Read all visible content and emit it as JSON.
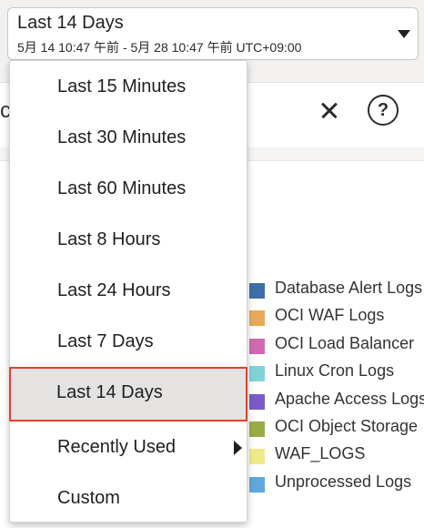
{
  "range": {
    "label": "Last 14 Days",
    "subtext": "5月 14 10:47 午前 - 5月 28 10:47 午前 UTC+09:00"
  },
  "toolbar": {
    "partial_text": "c"
  },
  "menu": {
    "items": [
      {
        "label": "Last 15 Minutes"
      },
      {
        "label": "Last 30 Minutes"
      },
      {
        "label": "Last 60 Minutes"
      },
      {
        "label": "Last 8 Hours"
      },
      {
        "label": "Last 24 Hours"
      },
      {
        "label": "Last 7 Days"
      },
      {
        "label": "Last 14 Days",
        "selected": true
      },
      {
        "label": "Recently Used",
        "has_submenu": true
      },
      {
        "label": "Custom"
      }
    ]
  },
  "legend": {
    "items": [
      {
        "label": "Database Alert Logs",
        "color": "#3d6fa6"
      },
      {
        "label": "OCI WAF Logs",
        "color": "#e8a95a"
      },
      {
        "label": "OCI Load Balancer",
        "color": "#d06ab0"
      },
      {
        "label": "Linux Cron Logs",
        "color": "#7fd3d6"
      },
      {
        "label": "Apache Access Logs",
        "color": "#7b5bc7"
      },
      {
        "label": "OCI Object Storage",
        "color": "#98ad47"
      },
      {
        "label": "WAF_LOGS",
        "color": "#f0ea8a"
      },
      {
        "label": "Unprocessed Logs",
        "color": "#5ea8dd"
      }
    ]
  },
  "icons": {
    "close": "close-icon",
    "help": "help-icon",
    "help_glyph": "?"
  },
  "colors": {
    "selected_outline": "#e0422a",
    "selected_bg": "#e4e3e1"
  }
}
